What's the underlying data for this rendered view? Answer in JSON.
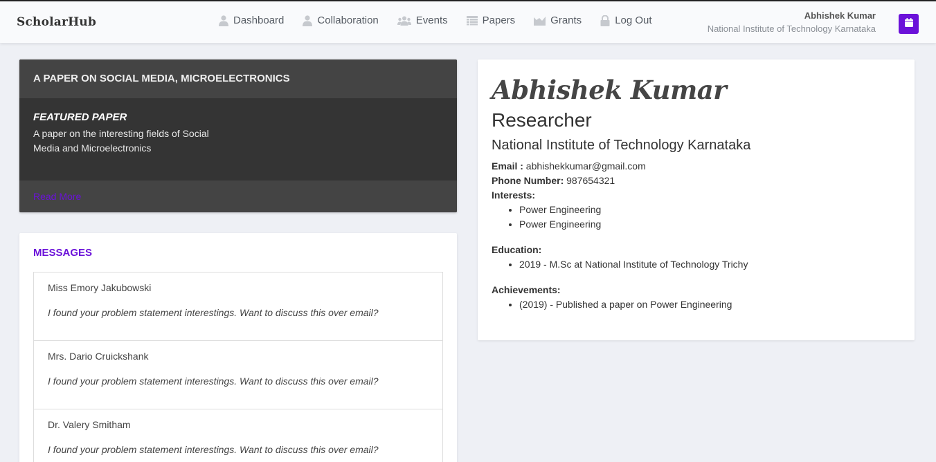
{
  "header": {
    "brand": "ScholarHub",
    "nav": [
      {
        "label": "Dashboard",
        "icon": "user-icon"
      },
      {
        "label": "Collaboration",
        "icon": "user-icon"
      },
      {
        "label": "Events",
        "icon": "users-icon"
      },
      {
        "label": "Papers",
        "icon": "table-icon"
      },
      {
        "label": "Grants",
        "icon": "chart-icon"
      },
      {
        "label": "Log Out",
        "icon": "lock-icon"
      }
    ],
    "user_name": "Abhishek Kumar",
    "user_institution": "National Institute of Technology Karnataka",
    "calendar_icon": "calendar-icon",
    "accent_color": "#6b11d9"
  },
  "featured": {
    "heading": "A PAPER ON SOCIAL MEDIA, MICROELECTRONICS",
    "kicker": "FEATURED PAPER",
    "description": "A paper on the interesting fields of Social Media and Microelectronics",
    "link": "Read More"
  },
  "messages": {
    "title": "MESSAGES",
    "items": [
      {
        "from": "Miss Emory Jakubowski",
        "text": "I found your problem statement interestings. Want to discuss this over email?"
      },
      {
        "from": "Mrs. Dario Cruickshank",
        "text": "I found your problem statement interestings. Want to discuss this over email?"
      },
      {
        "from": "Dr. Valery Smitham",
        "text": "I found your problem statement interestings. Want to discuss this over email?"
      }
    ]
  },
  "profile": {
    "name": "Abhishek Kumar",
    "role": "Researcher",
    "institution": "National Institute of Technology Karnataka",
    "email_label": "Email :",
    "email": "abhishekkumar@gmail.com",
    "phone_label": "Phone Number:",
    "phone": "987654321",
    "interests_label": "Interests:",
    "interests": [
      "Power Engineering",
      "Power Engineering"
    ],
    "education_label": "Education:",
    "education": [
      "2019 - M.Sc at National Institute of Technology Trichy"
    ],
    "achievements_label": "Achievements:",
    "achievements": [
      "(2019) - Published a paper on Power Engineering"
    ]
  }
}
